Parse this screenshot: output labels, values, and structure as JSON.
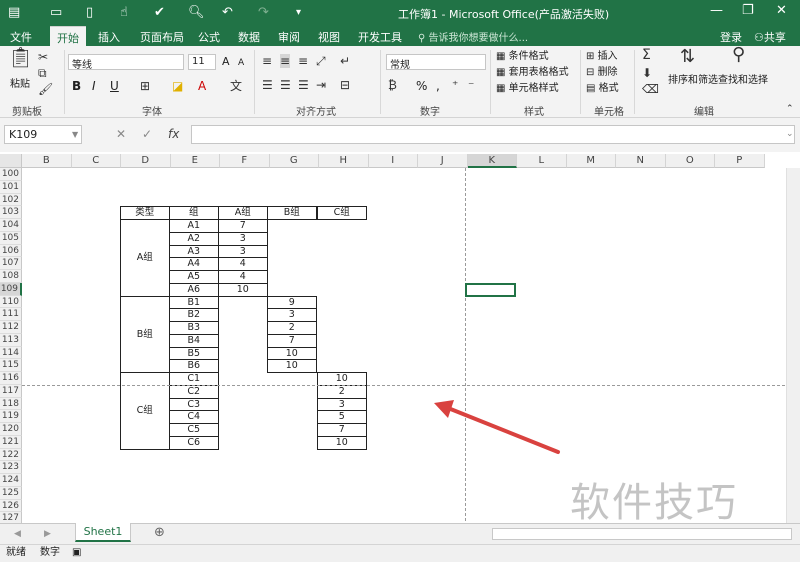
{
  "window": {
    "title": "工作簿1 - Microsoft Office(产品激活失败)",
    "minimize": "—",
    "restore": "❐",
    "close": "✕"
  },
  "ribbon_tabs": [
    "文件",
    "开始",
    "插入",
    "页面布局",
    "公式",
    "数据",
    "审阅",
    "视图",
    "开发工具"
  ],
  "tell_me": "告诉我你想要做什么...",
  "login": "登录",
  "share": "共享",
  "ribbon": {
    "clipboard": {
      "paste": "粘贴",
      "label": "剪贴板"
    },
    "font": {
      "name": "等线",
      "size": "11",
      "bold": "B",
      "italic": "I",
      "underline": "U",
      "grow": "A",
      "shrink": "A",
      "label": "字体"
    },
    "alignment": {
      "label": "对齐方式"
    },
    "number": {
      "format": "常规",
      "percent": "%",
      "comma": ",",
      "label": "数字"
    },
    "styles": {
      "conditional": "条件格式",
      "table": "套用表格格式",
      "cell": "单元格样式",
      "label": "样式"
    },
    "cells": {
      "insert": "插入",
      "delete": "删除",
      "format": "格式",
      "label": "单元格"
    },
    "editing": {
      "sort": "排序和筛选",
      "find": "查找和选择",
      "label": "编辑"
    }
  },
  "formula_bar": {
    "name_box": "K109",
    "cancel": "✕",
    "enter": "✓",
    "fx": "fx",
    "value": ""
  },
  "columns": [
    "B",
    "C",
    "D",
    "E",
    "F",
    "G",
    "H",
    "I",
    "J",
    "K",
    "L",
    "M",
    "N",
    "O",
    "P"
  ],
  "rows": [
    "100",
    "101",
    "102",
    "103",
    "104",
    "105",
    "106",
    "107",
    "108",
    "109",
    "110",
    "111",
    "112",
    "113",
    "114",
    "115",
    "116",
    "117",
    "118",
    "119",
    "120",
    "121",
    "122",
    "123",
    "124",
    "125",
    "126",
    "127"
  ],
  "table": {
    "headers": [
      "类型",
      "组",
      "A组",
      "B组",
      "C组"
    ],
    "groups": [
      {
        "type": "A组",
        "items": [
          {
            "name": "A1",
            "value": "7"
          },
          {
            "name": "A2",
            "value": "3"
          },
          {
            "name": "A3",
            "value": "3"
          },
          {
            "name": "A4",
            "value": "4"
          },
          {
            "name": "A5",
            "value": "4"
          },
          {
            "name": "A6",
            "value": "10"
          }
        ]
      },
      {
        "type": "B组",
        "items": [
          {
            "name": "B1",
            "value": "9"
          },
          {
            "name": "B2",
            "value": "3"
          },
          {
            "name": "B3",
            "value": "2"
          },
          {
            "name": "B4",
            "value": "7"
          },
          {
            "name": "B5",
            "value": "10"
          },
          {
            "name": "B6",
            "value": "10"
          }
        ]
      },
      {
        "type": "C组",
        "items": [
          {
            "name": "C1",
            "value": "10"
          },
          {
            "name": "C2",
            "value": "2"
          },
          {
            "name": "C3",
            "value": "3"
          },
          {
            "name": "C4",
            "value": "5"
          },
          {
            "name": "C5",
            "value": "7"
          },
          {
            "name": "C6",
            "value": "10"
          }
        ]
      }
    ]
  },
  "sheet_tabs": [
    "Sheet1"
  ],
  "add_sheet": "⊕",
  "status": {
    "ready": "就绪",
    "mode": "数字"
  },
  "watermark": "软件技巧",
  "colors": {
    "accent": "#217346",
    "arrow": "#d9423f"
  }
}
